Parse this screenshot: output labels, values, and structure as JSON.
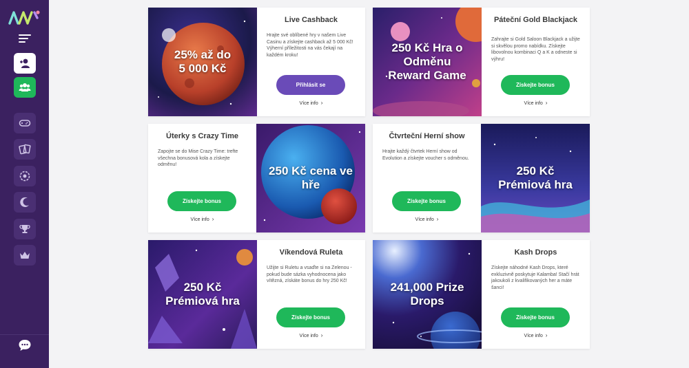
{
  "sidebar": {
    "logo": "logo",
    "items": [
      {
        "icon": "add-user-icon",
        "style": "white"
      },
      {
        "icon": "users-icon",
        "style": "green"
      },
      {
        "icon": "gamepad-icon",
        "style": "dark"
      },
      {
        "icon": "cards-icon",
        "style": "dark"
      },
      {
        "icon": "roulette-icon",
        "style": "dark"
      },
      {
        "icon": "moon-icon",
        "style": "dark"
      },
      {
        "icon": "trophy-icon",
        "style": "dark"
      },
      {
        "icon": "crown-icon",
        "style": "dark"
      }
    ],
    "chat_icon": "chat-icon"
  },
  "promos": [
    {
      "headline": "25% až do\n5 000 Kč",
      "title": "Live Cashback",
      "desc": "Hrajte své oblíbené hry v našem Live Casinu a získejte cashback až 5 000 Kč! Výherní příležitosti na vás čekají na každém kroku!",
      "button": "Přihlásit se",
      "more": "Více info"
    },
    {
      "headline": "250 Kč Hra o\nOdměnu\nReward Game",
      "title": "Páteční Gold Blackjack",
      "desc": "Zahrajte si Gold Saloon Blackjack a užijte si skvělou promo nabídku. Získejte libovolnou kombinaci Q a K a odneste si výhru!",
      "button": "Získejte bonus",
      "more": "Více info"
    },
    {
      "headline": "250 Kč cena ve\nhře",
      "title": "Úterky s Crazy Time",
      "desc": "Zapojte se do Mise Crazy Time: trefte všechna bonusová kola a získejte odměnu!",
      "button": "Získejte bonus",
      "more": "Více info"
    },
    {
      "headline": "250 Kč\nPrémiová hra",
      "title": "Čtvrteční Herní show",
      "desc": "Hrajte každý čtvrtek Herní show od Evolution a získejte voucher s odměnou.",
      "button": "Získejte bonus",
      "more": "Více info"
    },
    {
      "headline": "250 Kč\nPrémiová hra",
      "title": "Víkendová Ruleta",
      "desc": "Užijte si Ruletu a vsaďte si na Zelenou - pokud bude sázka vyhodnocena jako vítězná, získáte bonus do hry 250 Kč!",
      "button": "Získejte bonus",
      "more": "Více info"
    },
    {
      "headline": "241,000 Prize\nDrops",
      "title": "Kash Drops",
      "desc": "Získejte náhodné Kash Drops, které exkluzivně poskytuje Kalamba! Stačí hrát jakoukoli z kvalifikovaných her a máte šanci!",
      "button": "Získejte bonus",
      "more": "Více info"
    }
  ],
  "colors": {
    "sidebar": "#3b2160",
    "green": "#1fb85a",
    "purple_button": "#6a4bb8"
  }
}
